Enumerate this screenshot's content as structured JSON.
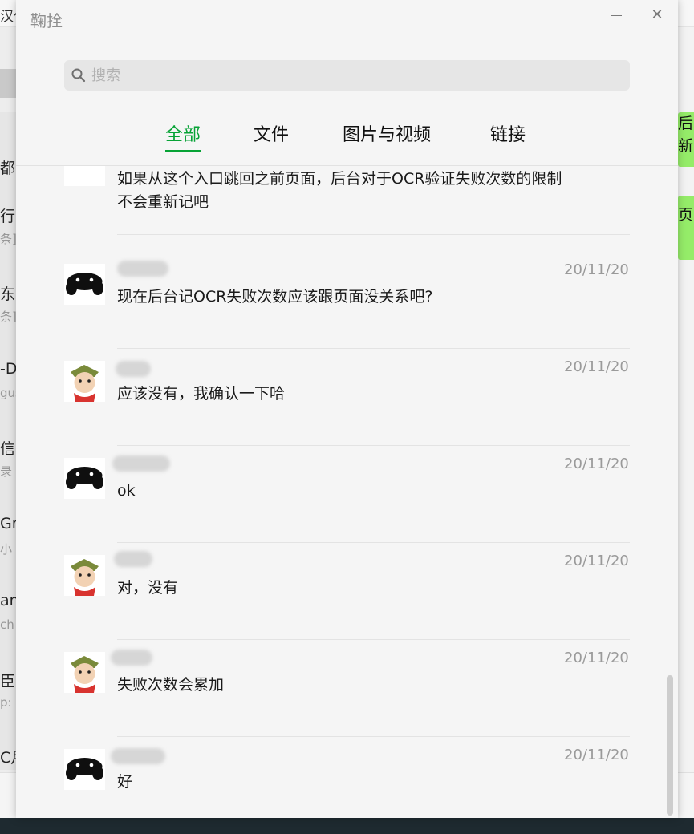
{
  "background": {
    "top_text": "汉化",
    "list_items": [
      {
        "title": "都",
        "sub": ""
      },
      {
        "title": "行",
        "sub": "条]"
      },
      {
        "title": "东",
        "sub": "条]"
      },
      {
        "title": "-D",
        "sub": "gus"
      },
      {
        "title": "信",
        "sub": "录"
      },
      {
        "title": "Gre",
        "sub": "小"
      },
      {
        "title": "an",
        "sub": "ch"
      },
      {
        "title": "臣",
        "sub": "p:"
      },
      {
        "title": "C月",
        "sub": ""
      }
    ],
    "right_bubbles": [
      {
        "text": "后台",
        "text2": "新"
      },
      {
        "text": "页面",
        "text2": ""
      }
    ]
  },
  "dialog": {
    "title": "鞠拴",
    "minimize_icon": "minimize-icon",
    "close_glyph": "✕",
    "search": {
      "placeholder": "搜索",
      "value": "",
      "icon": "search-icon"
    },
    "tabs": [
      {
        "label": "全部",
        "active": true
      },
      {
        "label": "文件",
        "active": false
      },
      {
        "label": "图片与视频",
        "active": false
      },
      {
        "label": "链接",
        "active": false
      }
    ],
    "accent_color": "#07a336",
    "messages": [
      {
        "avatar": "partial",
        "date": "",
        "text": "如果从这个入口跳回之前页面，后台对于OCR验证失败次数的限制不会重新记吧"
      },
      {
        "avatar": "gamepad-avatar",
        "date": "20/11/20",
        "text": "现在后台记OCR失败次数应该跟页面没关系吧?"
      },
      {
        "avatar": "cartoon-avatar",
        "date": "20/11/20",
        "text": "应该没有，我确认一下哈"
      },
      {
        "avatar": "gamepad-avatar",
        "date": "20/11/20",
        "text": "ok"
      },
      {
        "avatar": "cartoon-avatar",
        "date": "20/11/20",
        "text": "对，没有"
      },
      {
        "avatar": "cartoon-avatar",
        "date": "20/11/20",
        "text": "失败次数会累加"
      },
      {
        "avatar": "gamepad-avatar",
        "date": "20/11/20",
        "text": "好"
      }
    ]
  }
}
